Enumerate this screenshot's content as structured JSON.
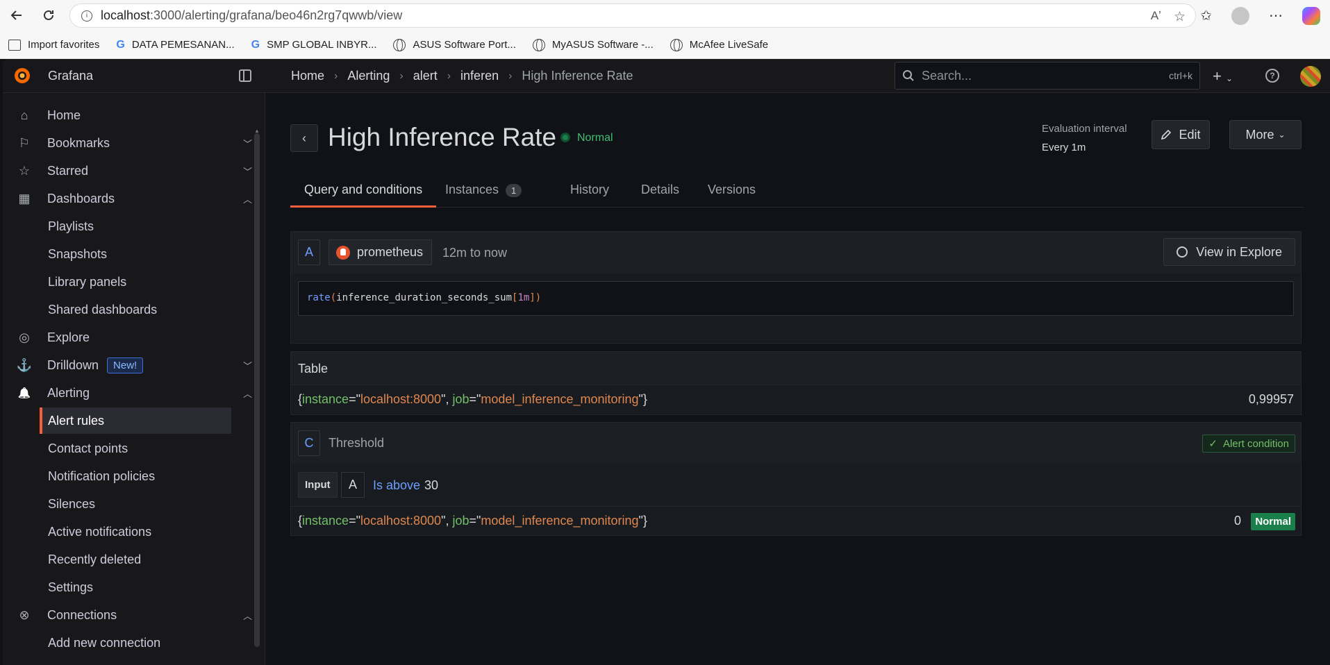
{
  "browser": {
    "url_host": "localhost",
    "url_path": ":3000/alerting/grafana/beo46n2rg7qwwb/view",
    "favorites": [
      {
        "label": "Import favorites",
        "icon": "import-icon"
      },
      {
        "label": "DATA PEMESANAN...",
        "icon": "google-icon"
      },
      {
        "label": "SMP GLOBAL INBYR...",
        "icon": "google-icon"
      },
      {
        "label": "ASUS Software Port...",
        "icon": "globe-icon"
      },
      {
        "label": "MyASUS Software -...",
        "icon": "globe-icon"
      },
      {
        "label": "McAfee LiveSafe",
        "icon": "globe-icon"
      }
    ]
  },
  "app": {
    "brand": "Grafana",
    "breadcrumb": [
      "Home",
      "Alerting",
      "alert",
      "inferen",
      "High Inference Rate"
    ],
    "search_placeholder": "Search...",
    "search_shortcut": "ctrl+k"
  },
  "sidebar": {
    "items": [
      {
        "label": "Home",
        "icon": "home-icon",
        "chevron": ""
      },
      {
        "label": "Bookmarks",
        "icon": "bookmark-icon",
        "chevron": "down"
      },
      {
        "label": "Starred",
        "icon": "star-icon",
        "chevron": "down"
      },
      {
        "label": "Dashboards",
        "icon": "apps-icon",
        "chevron": "up"
      },
      {
        "label": "Playlists",
        "sub": true
      },
      {
        "label": "Snapshots",
        "sub": true
      },
      {
        "label": "Library panels",
        "sub": true
      },
      {
        "label": "Shared dashboards",
        "sub": true
      },
      {
        "label": "Explore",
        "icon": "compass-icon",
        "chevron": ""
      },
      {
        "label": "Drilldown",
        "icon": "drilldown-icon",
        "chevron": "down",
        "badge": "New!"
      },
      {
        "label": "Alerting",
        "icon": "bell-icon",
        "chevron": "up"
      },
      {
        "label": "Alert rules",
        "sub": true,
        "active": true
      },
      {
        "label": "Contact points",
        "sub": true
      },
      {
        "label": "Notification policies",
        "sub": true
      },
      {
        "label": "Silences",
        "sub": true
      },
      {
        "label": "Active notifications",
        "sub": true
      },
      {
        "label": "Recently deleted",
        "sub": true
      },
      {
        "label": "Settings",
        "sub": true
      },
      {
        "label": "Connections",
        "icon": "connections-icon",
        "chevron": "up"
      },
      {
        "label": "Add new connection",
        "sub": true
      }
    ]
  },
  "rule": {
    "title": "High Inference Rate",
    "state": "Normal",
    "eval_label": "Evaluation interval",
    "eval_value": "Every 1m",
    "edit_label": "Edit",
    "more_label": "More"
  },
  "tabs": [
    {
      "label": "Query and conditions",
      "active": true
    },
    {
      "label": "Instances",
      "count": "1"
    },
    {
      "label": "History"
    },
    {
      "label": "Details"
    },
    {
      "label": "Versions"
    }
  ],
  "query": {
    "ref": "A",
    "datasource": "prometheus",
    "range": "12m to now",
    "explore_label": "View in Explore",
    "expr_fn": "rate",
    "expr_metric": "inference_duration_seconds_sum",
    "expr_range": "1m"
  },
  "table": {
    "title": "Table",
    "labels": [
      {
        "key": "instance",
        "value": "localhost:8000"
      },
      {
        "key": "job",
        "value": "model_inference_monitoring"
      }
    ],
    "value": "0,99957"
  },
  "threshold": {
    "ref": "C",
    "title": "Threshold",
    "alert_condition": "Alert condition",
    "input_label": "Input",
    "input_ref": "A",
    "operator": "Is above",
    "value": "30",
    "result_value": "0",
    "result_state": "Normal"
  }
}
